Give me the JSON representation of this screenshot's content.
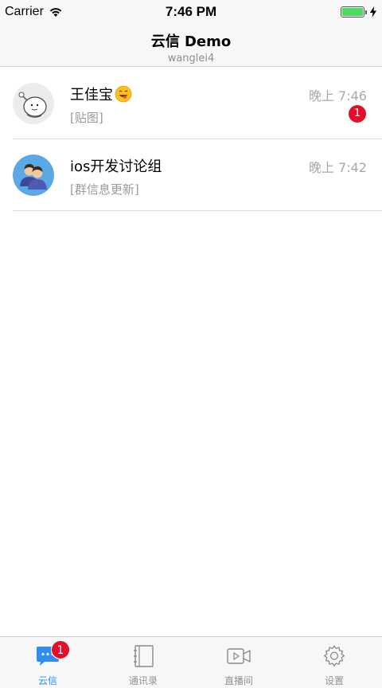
{
  "status_bar": {
    "carrier": "Carrier",
    "time": "7:46 PM",
    "battery_level": 1.0
  },
  "nav": {
    "title": "云信 Demo",
    "subtitle": "wanglei4"
  },
  "sessions": [
    {
      "name": "王佳宝",
      "emoji_icon": "grinning-tongue-emoji",
      "last_message": "[贴图]",
      "time": "晚上 7:46",
      "unread": "1",
      "avatar_icon": "cartoon-avatar"
    },
    {
      "name": "ios开发讨论组",
      "last_message": "[群信息更新]",
      "time": "晚上 7:42",
      "avatar_icon": "group-avatar"
    }
  ],
  "tabs": [
    {
      "label": "云信",
      "icon": "chat-bubble-icon",
      "badge": "1",
      "active": true
    },
    {
      "label": "通讯录",
      "icon": "contacts-book-icon"
    },
    {
      "label": "直播间",
      "icon": "video-camera-icon"
    },
    {
      "label": "设置",
      "icon": "gear-icon"
    }
  ],
  "colors": {
    "accent": "#2f8df0",
    "badge": "#e0102a",
    "battery": "#4cd964"
  }
}
